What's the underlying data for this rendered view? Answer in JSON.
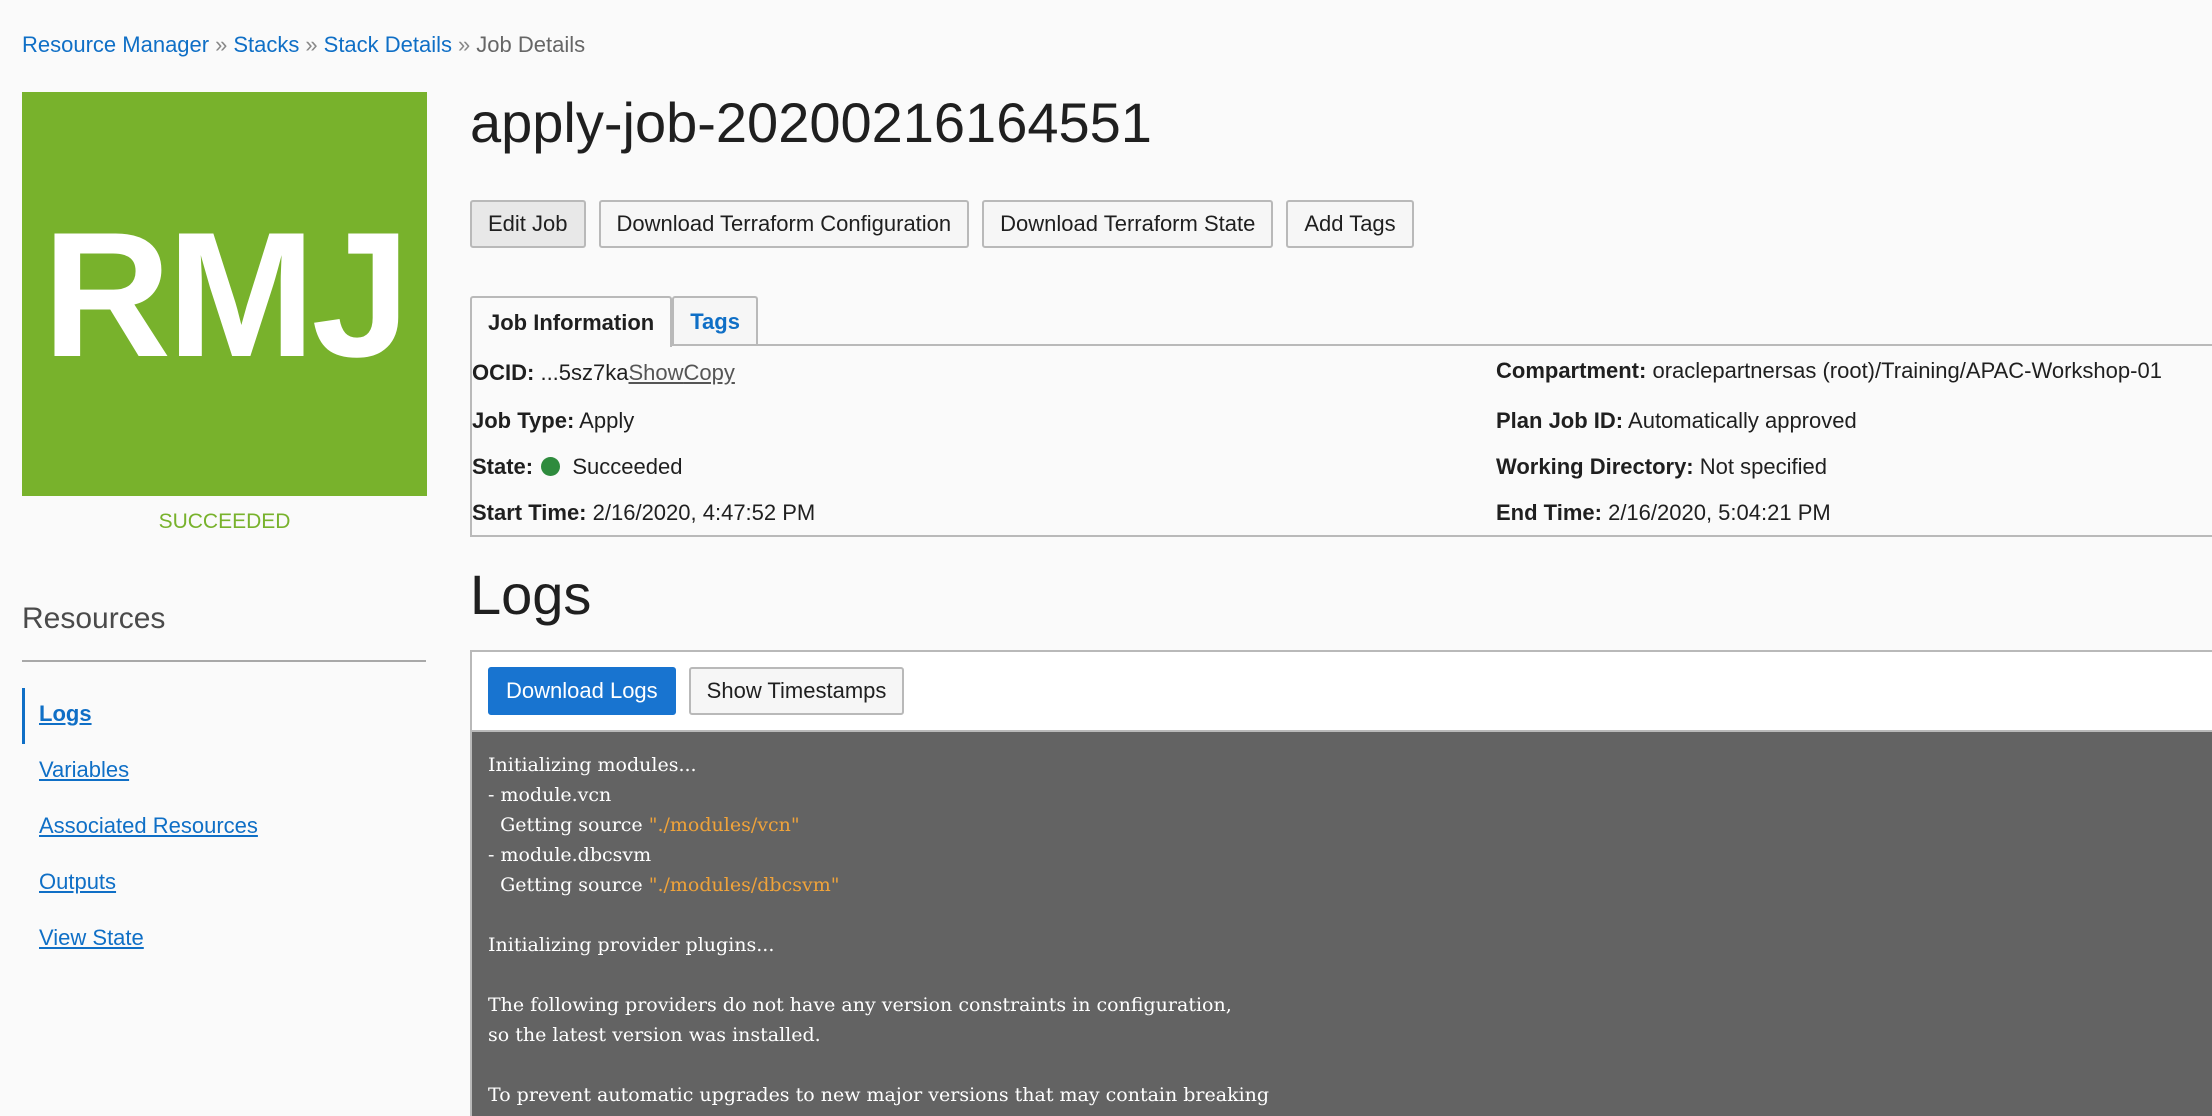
{
  "breadcrumb": {
    "items": [
      "Resource Manager",
      "Stacks",
      "Stack Details"
    ],
    "current": "Job Details",
    "separator": "»"
  },
  "badge": {
    "initials": "RMJ",
    "status": "SUCCEEDED",
    "color": "#78b22c"
  },
  "resources": {
    "title": "Resources",
    "items": [
      "Logs",
      "Variables",
      "Associated Resources",
      "Outputs",
      "View State"
    ],
    "active": "Logs"
  },
  "job": {
    "title": "apply-job-20200216164551",
    "actions": [
      "Edit Job",
      "Download Terraform Configuration",
      "Download Terraform State",
      "Add Tags"
    ]
  },
  "tabs": [
    "Job Information",
    "Tags"
  ],
  "info": {
    "ocid_label": "OCID:",
    "ocid_value": "...5sz7ka",
    "ocid_show": "Show",
    "ocid_copy": "Copy",
    "job_type_label": "Job Type:",
    "job_type_value": "Apply",
    "state_label": "State:",
    "state_value": "Succeeded",
    "state_color": "#2e8b3d",
    "start_label": "Start Time:",
    "start_value": "2/16/2020, 4:47:52 PM",
    "compartment_label": "Compartment:",
    "compartment_value": "oraclepartnersas (root)/Training/APAC-Workshop-01",
    "plan_label": "Plan Job ID:",
    "plan_value": "Automatically approved",
    "workdir_label": "Working Directory:",
    "workdir_value": "Not specified",
    "end_label": "End Time:",
    "end_value": "2/16/2020, 5:04:21 PM"
  },
  "logs": {
    "title": "Logs",
    "download_label": "Download Logs",
    "timestamps_label": "Show Timestamps",
    "lines": [
      {
        "text": "Initializing modules..."
      },
      {
        "text": "- module.vcn"
      },
      {
        "text": "  Getting source ",
        "str": "\"./modules/vcn\""
      },
      {
        "text": "- module.dbcsvm"
      },
      {
        "text": "  Getting source ",
        "str": "\"./modules/dbcsvm\""
      },
      {
        "text": ""
      },
      {
        "text": "Initializing provider plugins..."
      },
      {
        "text": ""
      },
      {
        "text": "The following providers do not have any version constraints in configuration,"
      },
      {
        "text": "so the latest version was installed."
      },
      {
        "text": ""
      },
      {
        "text": "To prevent automatic upgrades to new major versions that may contain breaking"
      }
    ]
  }
}
